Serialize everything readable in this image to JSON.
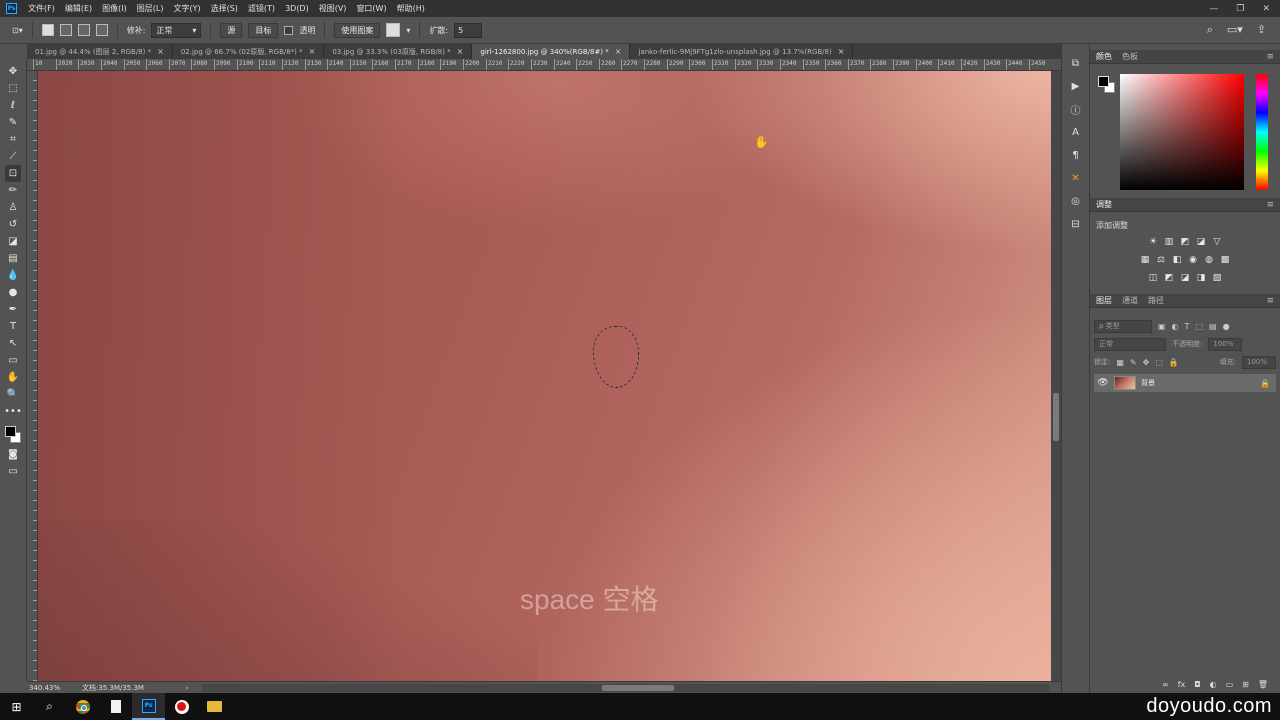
{
  "app": {
    "logo_text": "Ps",
    "menu": [
      "文件(F)",
      "编辑(E)",
      "图像(I)",
      "图层(L)",
      "文字(Y)",
      "选择(S)",
      "滤镜(T)",
      "3D(D)",
      "视图(V)",
      "窗口(W)",
      "帮助(H)"
    ],
    "window_controls": {
      "minimize": "—",
      "restore": "❐",
      "close": "✕"
    }
  },
  "options": {
    "patch_label": "修补:",
    "patch_mode": "正常",
    "source_label": "源",
    "target_label": "目标",
    "transparent_label": "透明",
    "use_pattern_label": "使用图案",
    "diffusion_label": "扩散:",
    "diffusion_value": "5"
  },
  "tabs": [
    {
      "label": "01.jpg @ 44.4% (图层 2, RGB/8) *",
      "close": "×",
      "active": false
    },
    {
      "label": "02.jpg @ 66.7% (02原版, RGB/8*) *",
      "close": "×",
      "active": false
    },
    {
      "label": "03.jpg @ 33.3% (03原版, RGB/8) *",
      "close": "×",
      "active": false
    },
    {
      "label": "girl-1262800.jpg @ 340%(RGB/8#) *",
      "close": "×",
      "active": true
    },
    {
      "label": "janko-ferlic-9Mj9FTg1zlo-unsplash.jpg @ 13.7%(RGB/8)",
      "close": "×",
      "active": false
    }
  ],
  "ruler": {
    "labels": [
      "10",
      "2020",
      "2030",
      "2040",
      "2050",
      "2060",
      "2070",
      "2080",
      "2090",
      "2100",
      "2110",
      "2120",
      "2130",
      "2140",
      "2150",
      "2160",
      "2170",
      "2180",
      "2190",
      "2200",
      "2210",
      "2220",
      "2230",
      "2240",
      "2250",
      "2260",
      "2270",
      "2280",
      "2290",
      "2300",
      "2310",
      "2320",
      "2330",
      "2340",
      "2350",
      "2360",
      "2370",
      "2380",
      "2390",
      "2400",
      "2410",
      "2420",
      "2430",
      "2440",
      "2450"
    ]
  },
  "tools": [
    {
      "name": "move-tool-icon",
      "glyph": "✥"
    },
    {
      "name": "marquee-tool-icon",
      "glyph": "⬚"
    },
    {
      "name": "lasso-tool-icon",
      "glyph": "ℓ"
    },
    {
      "name": "quick-select-tool-icon",
      "glyph": "✎"
    },
    {
      "name": "crop-tool-icon",
      "glyph": "⌗"
    },
    {
      "name": "eyedropper-tool-icon",
      "glyph": "⟋"
    },
    {
      "name": "patch-tool-icon",
      "glyph": "⊡"
    },
    {
      "name": "brush-tool-icon",
      "glyph": "✏"
    },
    {
      "name": "clone-stamp-tool-icon",
      "glyph": "♙"
    },
    {
      "name": "history-brush-tool-icon",
      "glyph": "↺"
    },
    {
      "name": "eraser-tool-icon",
      "glyph": "◪"
    },
    {
      "name": "gradient-tool-icon",
      "glyph": "▤"
    },
    {
      "name": "blur-tool-icon",
      "glyph": "💧"
    },
    {
      "name": "dodge-tool-icon",
      "glyph": "●"
    },
    {
      "name": "pen-tool-icon",
      "glyph": "✒"
    },
    {
      "name": "type-tool-icon",
      "glyph": "T"
    },
    {
      "name": "path-select-tool-icon",
      "glyph": "↖"
    },
    {
      "name": "shape-tool-icon",
      "glyph": "▭"
    },
    {
      "name": "hand-tool-icon",
      "glyph": "✋"
    },
    {
      "name": "zoom-tool-icon",
      "glyph": "🔍"
    },
    {
      "name": "more-tools-icon",
      "glyph": "•••"
    }
  ],
  "canvas": {
    "overlay_hint": "space 空格",
    "selection": "patch-selection"
  },
  "status": {
    "zoom": "340.43%",
    "doc_size": "文档:35.3M/35.3M",
    "arrow": "›"
  },
  "panels": {
    "color_tabs": [
      "颜色",
      "色板"
    ],
    "adjust_header": "调整",
    "adjust_title": "添加调整",
    "adjust_rows": [
      [
        "☀",
        "▥",
        "◩",
        "◪",
        "▽"
      ],
      [
        "▦",
        "⚖",
        "◧",
        "◉",
        "◍",
        "▩"
      ],
      [
        "◫",
        "◩",
        "◪",
        "◨",
        "▧"
      ]
    ],
    "layers_tabs": [
      "图层",
      "通道",
      "路径"
    ],
    "layers_filter": "ρ 类型",
    "layers_filter_icons": [
      "▣",
      "◐",
      "T",
      "⬚",
      "▤",
      "●"
    ],
    "blend_mode": "正常",
    "opacity_label": "不透明度:",
    "opacity_value": "100%",
    "lock_label": "锁定:",
    "lock_icons": [
      "▦",
      "✎",
      "✥",
      "⬚",
      "🔒"
    ],
    "fill_label": "填充:",
    "fill_value": "100%",
    "layer_name": "背景",
    "layer_eye": "👁",
    "layer_lock": "🔒",
    "footer_icons": [
      "∞",
      "fx",
      "◘",
      "◐",
      "▭",
      "⊞",
      "🗑"
    ],
    "menu_glyph": "≡",
    "collapse_glyph": "»"
  },
  "taskbar": {
    "start": "⊞",
    "search": "⌕",
    "ps_label": "Ps",
    "watermark": "doyoudo.com"
  }
}
